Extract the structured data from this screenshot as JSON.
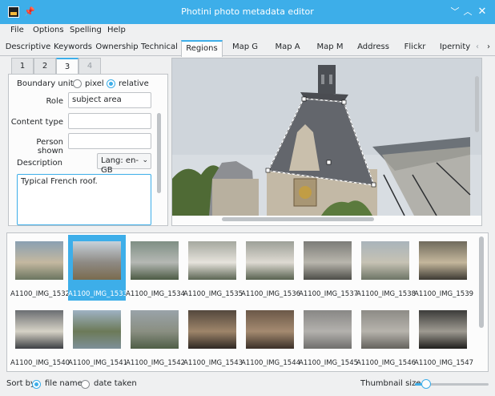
{
  "window": {
    "title": "Photini photo metadata editor"
  },
  "menu": [
    "File",
    "Options",
    "Spelling",
    "Help"
  ],
  "tabs": [
    "Descriptive",
    "Keywords",
    "Ownership",
    "Technical",
    "Regions",
    "Map G",
    "Map A",
    "Map M",
    "Address",
    "Flickr",
    "Ipernity"
  ],
  "active_tab": "Regions",
  "region_tabs": [
    "1",
    "2",
    "3",
    "4"
  ],
  "active_region_tab": "3",
  "form": {
    "boundary_unit_label": "Boundary unit",
    "pixel_label": "pixel",
    "relative_label": "relative",
    "boundary_unit_value": "relative",
    "role_label": "Role",
    "role_value": "subject area",
    "content_type_label": "Content type",
    "content_type_value": "",
    "person_shown_label": "Person shown",
    "person_shown_value": "",
    "description_label": "Description",
    "lang_label": "Lang: en-GB",
    "description_value": "Typical French roof."
  },
  "thumbnails": [
    {
      "name": "A1100_IMG_1532",
      "selected": false
    },
    {
      "name": "A1100_IMG_1533",
      "selected": true
    },
    {
      "name": "A1100_IMG_1534",
      "selected": false
    },
    {
      "name": "A1100_IMG_1535",
      "selected": false
    },
    {
      "name": "A1100_IMG_1536",
      "selected": false
    },
    {
      "name": "A1100_IMG_1537",
      "selected": false
    },
    {
      "name": "A1100_IMG_1538",
      "selected": false
    },
    {
      "name": "A1100_IMG_1539",
      "selected": false
    },
    {
      "name": "A1100_IMG_1540",
      "selected": false
    },
    {
      "name": "A1100_IMG_1541",
      "selected": false
    },
    {
      "name": "A1100_IMG_1542",
      "selected": false
    },
    {
      "name": "A1100_IMG_1543",
      "selected": false
    },
    {
      "name": "A1100_IMG_1544",
      "selected": false
    },
    {
      "name": "A1100_IMG_1545",
      "selected": false
    },
    {
      "name": "A1100_IMG_1546",
      "selected": false
    },
    {
      "name": "A1100_IMG_1547",
      "selected": false
    }
  ],
  "sort": {
    "label": "Sort by",
    "file_name": "file name",
    "date_taken": "date taken",
    "value": "file name"
  },
  "thumbnail_size": {
    "label": "Thumbnail size",
    "level": 0.15
  },
  "colors": {
    "accent": "#3daee9",
    "window_bg": "#eff0f1",
    "region_outline": "#ffffff"
  }
}
